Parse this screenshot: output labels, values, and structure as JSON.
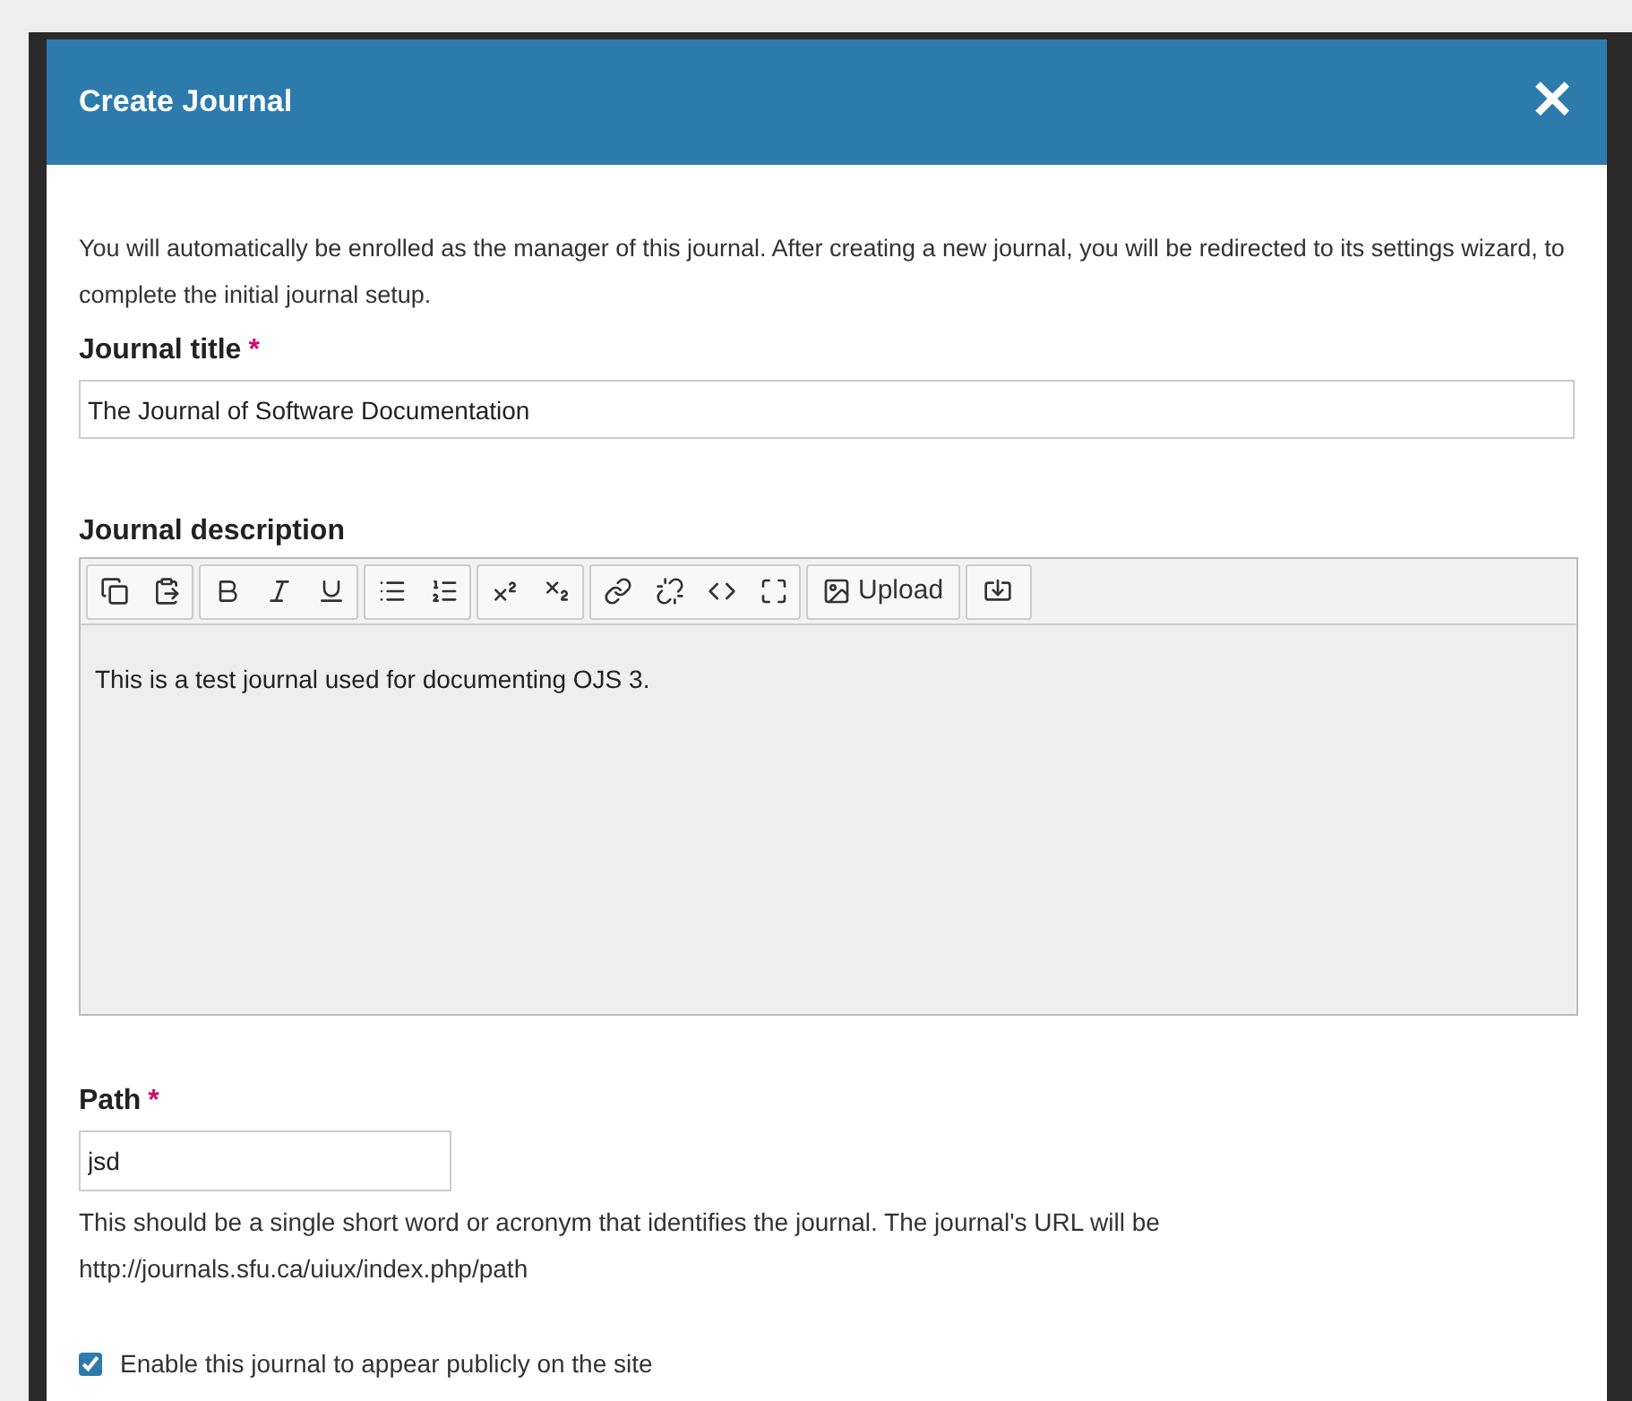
{
  "dialog": {
    "title": "Create Journal",
    "close_label": "✕"
  },
  "intro": "You will automatically be enrolled as the manager of this journal. After creating a new journal, you will be redirected to its settings wizard, to complete the initial journal setup.",
  "fields": [
    {
      "label": "Journal title",
      "required_mark": "*",
      "value": "The Journal of Software Documentation"
    }
  ],
  "description": {
    "label": "Journal description",
    "upload_label": "Upload",
    "value": "This is a test journal used for documenting OJS 3."
  },
  "path": {
    "label": "Path",
    "required_mark": "*",
    "value": "jsd",
    "help": "This should be a single short word or acronym that identifies the journal. The journal's URL will be http://journals.sfu.ca/uiux/index.php/path"
  },
  "enable": {
    "label": "Enable this journal to appear publicly on the site",
    "checked": true
  }
}
